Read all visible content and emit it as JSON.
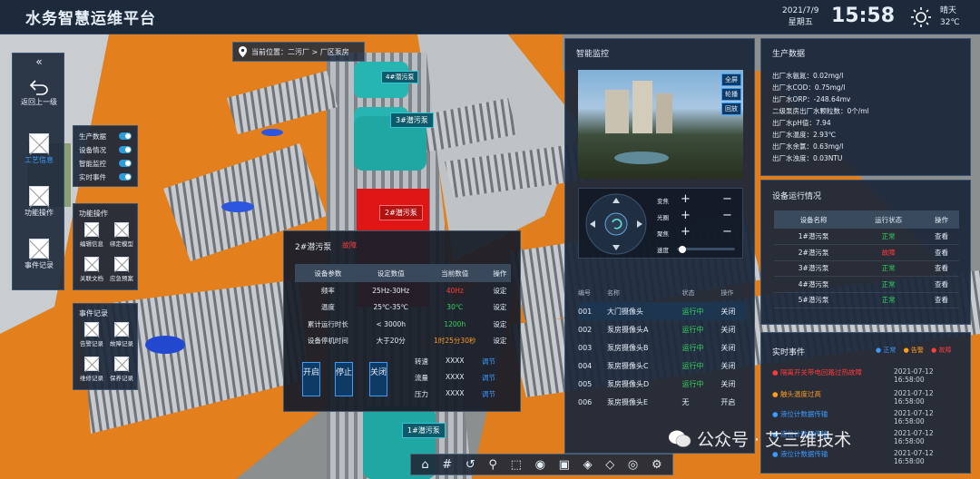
{
  "header": {
    "title": "水务智慧运维平台",
    "date": "2021/7/9",
    "weekday": "星期五",
    "time": "15:58",
    "weather": "晴天",
    "temp": "32℃"
  },
  "breadcrumb": {
    "label": "当前位置：",
    "path": "二污厂 > 厂区泵房"
  },
  "left_nav": {
    "collapse": "«",
    "back": "返回上一级",
    "process": "工艺信息",
    "function": "功能操作",
    "events": "事件记录"
  },
  "layers": [
    {
      "label": "生产数据"
    },
    {
      "label": "设备情况"
    },
    {
      "label": "智能监控"
    },
    {
      "label": "实时事件"
    }
  ],
  "func_ops": {
    "title": "功能操作",
    "items": [
      "编辑信息",
      "绑定模型",
      "关联文档",
      "应急预案"
    ]
  },
  "event_records": {
    "title": "事件记录",
    "items": [
      "告警记录",
      "故障记录",
      "维修记录",
      "保养记录"
    ]
  },
  "scene_tags": {
    "t4": "4#潜污泵",
    "t3": "3#潜污泵",
    "t2": "2#潜污泵",
    "t1": "1#潜污泵"
  },
  "pump_popup": {
    "title": "2#潜污泵",
    "status": "故障",
    "headers": [
      "设备参数",
      "设定数值",
      "当前数值",
      "操作"
    ],
    "rows": [
      [
        "频率",
        "25Hz-30Hz",
        "40Hz",
        "设定"
      ],
      [
        "温度",
        "25℃-35℃",
        "30℃",
        "设定"
      ],
      [
        "累计运行时长",
        "< 3000h",
        "1200h",
        "设定"
      ],
      [
        "设备停机时间",
        "大于20分",
        "1时25分30秒",
        "设定"
      ]
    ],
    "buttons": {
      "start": "开启",
      "stop": "停止",
      "close": "关闭"
    },
    "controls": [
      {
        "label": "转速",
        "value": "XXXX",
        "action": "调节"
      },
      {
        "label": "流量",
        "value": "XXXX",
        "action": "调节"
      },
      {
        "label": "压力",
        "value": "XXXX",
        "action": "调节"
      }
    ]
  },
  "monitor": {
    "title": "智能监控",
    "buttons": [
      "全屏",
      "轮播",
      "回放"
    ],
    "ptz": [
      {
        "label": "变焦"
      },
      {
        "label": "光圈"
      },
      {
        "label": "聚焦"
      },
      {
        "label": "速度"
      }
    ],
    "table_headers": [
      "编号",
      "名称",
      "状态",
      "操作"
    ],
    "cameras": [
      [
        "001",
        "大门摄像头",
        "运行中",
        "关闭"
      ],
      [
        "002",
        "泵房摄像头A",
        "运行中",
        "关闭"
      ],
      [
        "003",
        "泵房摄像头B",
        "运行中",
        "关闭"
      ],
      [
        "004",
        "泵房摄像头C",
        "运行中",
        "关闭"
      ],
      [
        "005",
        "泵房摄像头D",
        "运行中",
        "关闭"
      ],
      [
        "006",
        "泵房摄像头E",
        "无",
        "开启"
      ]
    ]
  },
  "production": {
    "title": "生产数据",
    "lines": [
      "出厂水氨氮：0.02mg/l",
      "出厂水COD：0.75mg/l",
      "出厂水ORP：-248.64mv",
      "二级泵房出厂水颗粒数：0个/ml",
      "出厂水pH值：7.94",
      "出厂水温度：2.93℃",
      "出厂水余氯：0.63mg/l",
      "出厂水浊度：0.03NTU"
    ]
  },
  "devices": {
    "title": "设备运行情况",
    "headers": [
      "设备名称",
      "运行状态",
      "操作"
    ],
    "rows": [
      [
        "1#潜污泵",
        "正常",
        "查看"
      ],
      [
        "2#潜污泵",
        "故障",
        "查看"
      ],
      [
        "3#潜污泵",
        "正常",
        "查看"
      ],
      [
        "4#潜污泵",
        "正常",
        "查看"
      ],
      [
        "5#潜污泵",
        "正常",
        "查看"
      ]
    ]
  },
  "events": {
    "title": "实时事件",
    "legend": [
      "正常",
      "告警",
      "故障"
    ],
    "rows": [
      {
        "text": "隔离开关带电回路过热故障",
        "date": "2021-07-12 16:58:00",
        "level": "fault"
      },
      {
        "text": "触头温度过高",
        "date": "2021-07-12 16:58:00",
        "level": "warn"
      },
      {
        "text": "液位计数据传输",
        "date": "2021-07-12 16:58:00",
        "level": "normal"
      },
      {
        "text": "液位计数据传输",
        "date": "2021-07-12 16:58:00",
        "level": "normal"
      },
      {
        "text": "液位计数据传输",
        "date": "2021-07-12 16:58:00",
        "level": "normal"
      }
    ]
  },
  "watermark": "公众号 · 艾三维技术",
  "colors": {
    "normal": "#35d05c",
    "fault": "#ff3b3b",
    "warn": "#ff9c1e",
    "info": "#3c9bff",
    "bg": "#1c283a"
  }
}
